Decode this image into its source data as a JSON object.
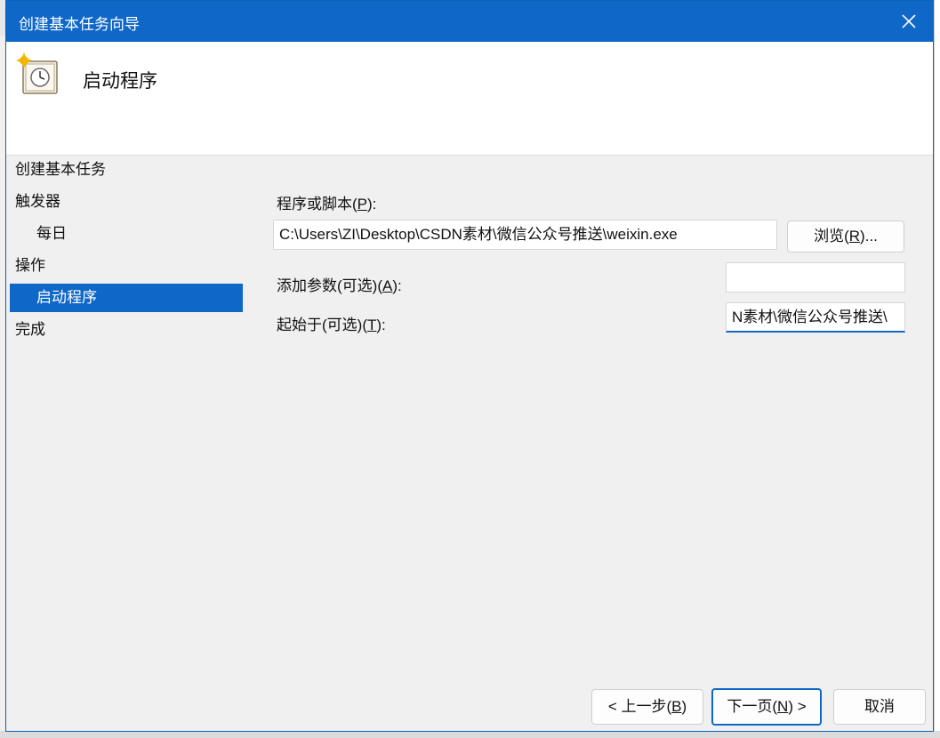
{
  "window": {
    "title": "创建基本任务向导"
  },
  "header": {
    "title": "启动程序",
    "icon": "task-clock-icon"
  },
  "sidebar": {
    "items": [
      {
        "label": "创建基本任务"
      },
      {
        "label": "触发器"
      },
      {
        "label": "每日"
      },
      {
        "label": "操作"
      },
      {
        "label": "启动程序"
      },
      {
        "label": "完成"
      }
    ],
    "selected": "启动程序"
  },
  "form": {
    "program_label": "程序或脚本",
    "program_key": "P",
    "program_value": "C:\\Users\\ZI\\Desktop\\CSDN素材\\微信公众号推送\\weixin.exe",
    "browse_label": "浏览",
    "browse_key": "R",
    "browse_suffix": "...",
    "args_label": "添加参数(可选)",
    "args_key": "A",
    "args_value": "",
    "start_label": "起始于(可选)",
    "start_key": "T",
    "start_value": "N素材\\微信公众号推送\\"
  },
  "footer": {
    "back_prefix": "< ",
    "back_label": "上一步",
    "back_key": "B",
    "next_label": "下一页",
    "next_key": "N",
    "next_suffix": " >",
    "cancel_label": "取消"
  },
  "colors": {
    "accent": "#0f67c8"
  }
}
